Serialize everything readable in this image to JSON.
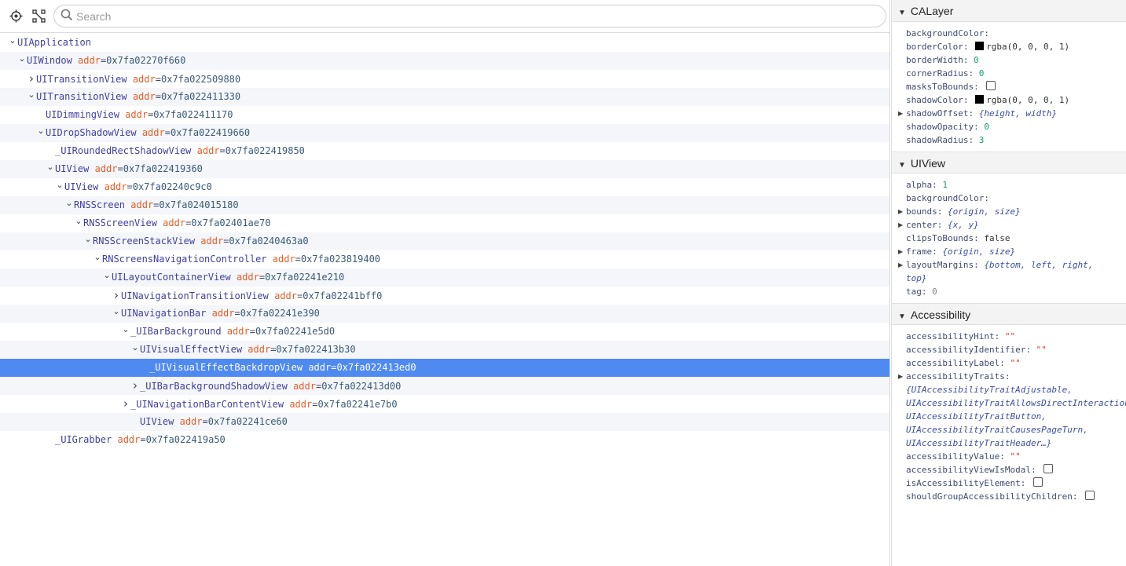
{
  "toolbar": {
    "search_placeholder": "Search"
  },
  "tree": [
    {
      "depth": 0,
      "caret": "down",
      "name": "UIApplication",
      "addr": ""
    },
    {
      "depth": 1,
      "caret": "down",
      "name": "UIWindow",
      "addr": "0x7fa02270f660"
    },
    {
      "depth": 2,
      "caret": "right",
      "name": "UITransitionView",
      "addr": "0x7fa022509880"
    },
    {
      "depth": 2,
      "caret": "down",
      "name": "UITransitionView",
      "addr": "0x7fa022411330"
    },
    {
      "depth": 3,
      "caret": "none",
      "name": "UIDimmingView",
      "addr": "0x7fa022411170"
    },
    {
      "depth": 3,
      "caret": "down",
      "name": "UIDropShadowView",
      "addr": "0x7fa022419660"
    },
    {
      "depth": 4,
      "caret": "none",
      "name": "_UIRoundedRectShadowView",
      "addr": "0x7fa022419850"
    },
    {
      "depth": 4,
      "caret": "down",
      "name": "UIView",
      "addr": "0x7fa022419360"
    },
    {
      "depth": 5,
      "caret": "down",
      "name": "UIView",
      "addr": "0x7fa02240c9c0"
    },
    {
      "depth": 6,
      "caret": "down",
      "name": "RNSScreen",
      "addr": "0x7fa024015180"
    },
    {
      "depth": 7,
      "caret": "down",
      "name": "RNSScreenView",
      "addr": "0x7fa02401ae70"
    },
    {
      "depth": 8,
      "caret": "down",
      "name": "RNSScreenStackView",
      "addr": "0x7fa0240463a0"
    },
    {
      "depth": 9,
      "caret": "down",
      "name": "RNScreensNavigationController",
      "addr": "0x7fa023819400"
    },
    {
      "depth": 10,
      "caret": "down",
      "name": "UILayoutContainerView",
      "addr": "0x7fa02241e210"
    },
    {
      "depth": 11,
      "caret": "right",
      "name": "UINavigationTransitionView",
      "addr": "0x7fa02241bff0"
    },
    {
      "depth": 11,
      "caret": "down",
      "name": "UINavigationBar",
      "addr": "0x7fa02241e390"
    },
    {
      "depth": 12,
      "caret": "down",
      "name": "_UIBarBackground",
      "addr": "0x7fa02241e5d0"
    },
    {
      "depth": 13,
      "caret": "down",
      "name": "UIVisualEffectView",
      "addr": "0x7fa022413b30"
    },
    {
      "depth": 14,
      "caret": "none",
      "name": "_UIVisualEffectBackdropView",
      "addr": "0x7fa022413ed0",
      "selected": true
    },
    {
      "depth": 13,
      "caret": "right",
      "name": "_UIBarBackgroundShadowView",
      "addr": "0x7fa022413d00"
    },
    {
      "depth": 12,
      "caret": "right",
      "name": "_UINavigationBarContentView",
      "addr": "0x7fa02241e7b0"
    },
    {
      "depth": 13,
      "caret": "none",
      "name": "UIView",
      "addr": "0x7fa02241ce60"
    },
    {
      "depth": 4,
      "caret": "none",
      "name": "_UIGrabber",
      "addr": "0x7fa022419a50"
    }
  ],
  "addr_key": "addr",
  "sections": [
    {
      "title": "CALayer",
      "props": [
        {
          "key": "backgroundColor",
          "kind": "empty"
        },
        {
          "key": "borderColor",
          "kind": "color",
          "value": "rgba(0, 0, 0, 1)"
        },
        {
          "key": "borderWidth",
          "kind": "num",
          "value": "0"
        },
        {
          "key": "cornerRadius",
          "kind": "num",
          "value": "0"
        },
        {
          "key": "masksToBounds",
          "kind": "checkbox"
        },
        {
          "key": "shadowColor",
          "kind": "color",
          "value": "rgba(0, 0, 0, 1)"
        },
        {
          "key": "shadowOffset",
          "kind": "obj",
          "expand": true,
          "value": "{height, width}"
        },
        {
          "key": "shadowOpacity",
          "kind": "num",
          "value": "0"
        },
        {
          "key": "shadowRadius",
          "kind": "num",
          "value": "3"
        }
      ]
    },
    {
      "title": "UIView",
      "props": [
        {
          "key": "alpha",
          "kind": "num",
          "value": "1"
        },
        {
          "key": "backgroundColor",
          "kind": "empty"
        },
        {
          "key": "bounds",
          "kind": "obj",
          "expand": true,
          "value": "{origin, size}"
        },
        {
          "key": "center",
          "kind": "obj",
          "expand": true,
          "value": "{x, y}"
        },
        {
          "key": "clipsToBounds",
          "kind": "plain",
          "value": "false"
        },
        {
          "key": "frame",
          "kind": "obj",
          "expand": true,
          "value": "{origin, size}"
        },
        {
          "key": "layoutMargins",
          "kind": "obj",
          "expand": true,
          "value": "{bottom, left, right,",
          "cont": [
            "top}"
          ]
        },
        {
          "key": "tag",
          "kind": "numgray",
          "value": "0"
        }
      ]
    },
    {
      "title": "Accessibility",
      "props": [
        {
          "key": "accessibilityHint",
          "kind": "str",
          "value": "\"\""
        },
        {
          "key": "accessibilityIdentifier",
          "kind": "str",
          "value": "\"\""
        },
        {
          "key": "accessibilityLabel",
          "kind": "str",
          "value": "\"\""
        },
        {
          "key": "accessibilityTraits",
          "kind": "empty",
          "expand": true,
          "cont": [
            "{UIAccessibilityTraitAdjustable,",
            "UIAccessibilityTraitAllowsDirectInteraction,",
            "UIAccessibilityTraitButton,",
            "UIAccessibilityTraitCausesPageTurn,",
            "UIAccessibilityTraitHeader…}"
          ]
        },
        {
          "key": "accessibilityValue",
          "kind": "str",
          "value": "\"\""
        },
        {
          "key": "accessibilityViewIsModal",
          "kind": "checkbox"
        },
        {
          "key": "isAccessibilityElement",
          "kind": "checkbox"
        },
        {
          "key": "shouldGroupAccessibilityChildren",
          "kind": "checkbox"
        }
      ]
    }
  ]
}
